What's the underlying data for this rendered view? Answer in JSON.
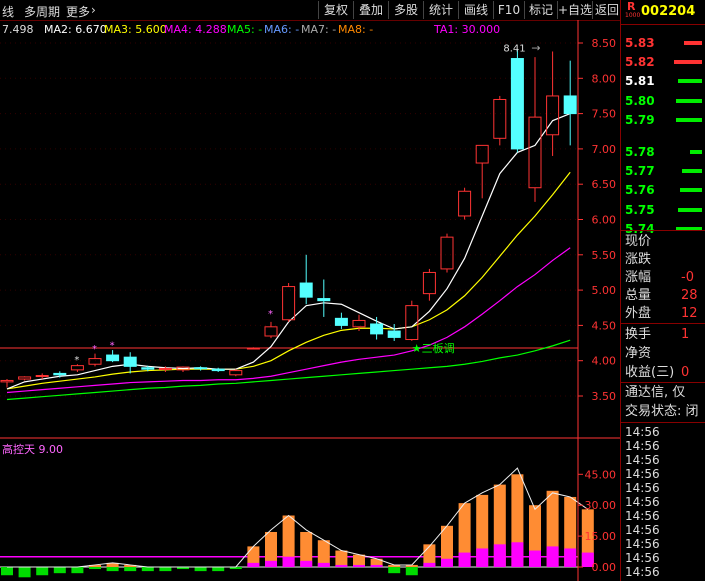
{
  "toolbar": {
    "left_items": [
      "线",
      "多周期",
      "更多"
    ],
    "more_arrow": "›",
    "buttons": [
      "复权",
      "叠加",
      "多股",
      "统计",
      "画线",
      "F10",
      "标记",
      "+自选",
      "返回"
    ]
  },
  "ma_bar": {
    "price": "7.498",
    "ma2": "MA2: 6.670",
    "ma3": "MA3: 5.600",
    "ma4": "MA4: 4.288",
    "ma5": "MA5: -",
    "ma6": "MA6: -",
    "ma7": "MA7: -",
    "ma8": "MA8: -",
    "ta1": "TA1: 30.000"
  },
  "colors": {
    "up": "#ff3333",
    "down": "#54ffff",
    "ma2": "#ffffff",
    "ma3": "#ffff00",
    "ma4": "#ff00ff",
    "ma5": "#00ff00",
    "ta1": "#ff00ff",
    "axis": "#ff3333",
    "green_bar": "#00dd00"
  },
  "main_chart": {
    "y_ticks": [
      "8.50",
      "8.00",
      "7.50",
      "7.00",
      "6.50",
      "6.00",
      "5.50",
      "5.00",
      "4.50",
      "4.00",
      "3.50"
    ],
    "annotation_top": "8.41",
    "annotation_arrow": "→",
    "annotation_signal": "★三板调",
    "stars": [
      "*",
      "*",
      "*",
      "*"
    ],
    "candles": [
      {
        "o": 3.7,
        "h": 3.74,
        "l": 3.62,
        "c": 3.72
      },
      {
        "o": 3.74,
        "h": 3.78,
        "l": 3.72,
        "c": 3.77
      },
      {
        "o": 3.78,
        "h": 3.82,
        "l": 3.74,
        "c": 3.79
      },
      {
        "o": 3.82,
        "h": 3.85,
        "l": 3.76,
        "c": 3.8
      },
      {
        "o": 3.87,
        "h": 3.95,
        "l": 3.84,
        "c": 3.93
      },
      {
        "o": 3.95,
        "h": 4.1,
        "l": 3.92,
        "c": 4.03
      },
      {
        "o": 4.08,
        "h": 4.15,
        "l": 3.98,
        "c": 4.0
      },
      {
        "o": 4.05,
        "h": 4.12,
        "l": 3.82,
        "c": 3.92
      },
      {
        "o": 3.9,
        "h": 3.93,
        "l": 3.85,
        "c": 3.88
      },
      {
        "o": 3.88,
        "h": 3.92,
        "l": 3.84,
        "c": 3.89
      },
      {
        "o": 3.87,
        "h": 3.92,
        "l": 3.84,
        "c": 3.91
      },
      {
        "o": 3.9,
        "h": 3.92,
        "l": 3.86,
        "c": 3.89
      },
      {
        "o": 3.88,
        "h": 3.9,
        "l": 3.84,
        "c": 3.86
      },
      {
        "o": 3.8,
        "h": 3.88,
        "l": 3.78,
        "c": 3.86
      },
      {
        "o": 4.18,
        "h": 4.19,
        "l": 4.17,
        "c": 4.18
      },
      {
        "o": 4.35,
        "h": 4.55,
        "l": 4.32,
        "c": 4.48
      },
      {
        "o": 4.58,
        "h": 5.1,
        "l": 4.55,
        "c": 5.05
      },
      {
        "o": 5.1,
        "h": 5.5,
        "l": 4.8,
        "c": 4.9
      },
      {
        "o": 4.88,
        "h": 5.15,
        "l": 4.62,
        "c": 4.85
      },
      {
        "o": 4.6,
        "h": 4.68,
        "l": 4.45,
        "c": 4.5
      },
      {
        "o": 4.48,
        "h": 4.65,
        "l": 4.42,
        "c": 4.57
      },
      {
        "o": 4.52,
        "h": 4.62,
        "l": 4.3,
        "c": 4.38
      },
      {
        "o": 4.42,
        "h": 4.52,
        "l": 4.28,
        "c": 4.33
      },
      {
        "o": 4.3,
        "h": 4.85,
        "l": 4.28,
        "c": 4.78
      },
      {
        "o": 4.95,
        "h": 5.3,
        "l": 4.85,
        "c": 5.25
      },
      {
        "o": 5.3,
        "h": 5.8,
        "l": 5.25,
        "c": 5.75
      },
      {
        "o": 6.05,
        "h": 6.45,
        "l": 6.0,
        "c": 6.4
      },
      {
        "o": 6.8,
        "h": 7.05,
        "l": 6.3,
        "c": 7.05
      },
      {
        "o": 7.15,
        "h": 7.75,
        "l": 7.05,
        "c": 7.7
      },
      {
        "o": 8.28,
        "h": 8.41,
        "l": 6.95,
        "c": 7.0
      },
      {
        "o": 6.45,
        "h": 8.3,
        "l": 6.25,
        "c": 7.45
      },
      {
        "o": 7.2,
        "h": 8.38,
        "l": 6.9,
        "c": 7.75
      },
      {
        "o": 7.75,
        "h": 8.25,
        "l": 7.05,
        "c": 7.5
      }
    ],
    "ma2": [
      3.6,
      3.7,
      3.74,
      3.78,
      3.8,
      3.86,
      3.92,
      3.95,
      3.92,
      3.9,
      3.89,
      3.9,
      3.88,
      3.88,
      3.98,
      4.2,
      4.55,
      4.78,
      4.82,
      4.8,
      4.68,
      4.56,
      4.45,
      4.48,
      4.7,
      5.02,
      5.45,
      6.05,
      6.65,
      6.95,
      7.05,
      7.4,
      7.5
    ],
    "ma3": [
      3.6,
      3.64,
      3.68,
      3.71,
      3.74,
      3.77,
      3.81,
      3.84,
      3.86,
      3.87,
      3.88,
      3.88,
      3.88,
      3.88,
      3.92,
      4.0,
      4.14,
      4.26,
      4.36,
      4.43,
      4.46,
      4.46,
      4.45,
      4.48,
      4.58,
      4.72,
      4.92,
      5.18,
      5.48,
      5.78,
      6.05,
      6.35,
      6.67
    ],
    "ma4": [
      3.55,
      3.57,
      3.59,
      3.61,
      3.63,
      3.65,
      3.67,
      3.69,
      3.7,
      3.71,
      3.72,
      3.72,
      3.73,
      3.73,
      3.75,
      3.78,
      3.83,
      3.88,
      3.93,
      3.98,
      4.02,
      4.05,
      4.08,
      4.14,
      4.22,
      4.33,
      4.48,
      4.66,
      4.85,
      5.05,
      5.22,
      5.42,
      5.6
    ],
    "ma5": [
      3.45,
      3.47,
      3.49,
      3.51,
      3.53,
      3.55,
      3.57,
      3.59,
      3.61,
      3.62,
      3.64,
      3.65,
      3.67,
      3.68,
      3.7,
      3.72,
      3.74,
      3.76,
      3.78,
      3.8,
      3.82,
      3.84,
      3.86,
      3.88,
      3.9,
      3.92,
      3.95,
      3.99,
      4.04,
      4.08,
      4.14,
      4.21,
      4.29
    ]
  },
  "sub_chart": {
    "title": "高控天 9.00",
    "y_ticks": [
      "45.00",
      "30.00",
      "15.00",
      "0.00"
    ],
    "orange": [
      0,
      0,
      0,
      0,
      0,
      1,
      2,
      1,
      0,
      0,
      0,
      0,
      0,
      0,
      10,
      17,
      25,
      17,
      13,
      8,
      6,
      4,
      1,
      1,
      11,
      20,
      31,
      35,
      40,
      45,
      30,
      37,
      34,
      28
    ],
    "magenta": [
      0,
      0,
      0,
      0,
      0,
      0,
      0,
      0,
      0,
      0,
      0,
      0,
      0,
      0,
      2,
      3,
      5,
      3,
      2,
      1,
      1,
      1,
      0,
      0,
      2,
      4,
      7,
      9,
      11,
      12,
      8,
      10,
      9,
      7
    ],
    "green": [
      -4,
      -5,
      -4,
      -3,
      -3,
      -1,
      -2,
      -2,
      -2,
      -2,
      -1,
      -2,
      -2,
      -1,
      0,
      0,
      0,
      0,
      0,
      0,
      0,
      0,
      -3,
      -4,
      0,
      0,
      0,
      0,
      0,
      0,
      0,
      0,
      0,
      0
    ],
    "line": [
      0,
      0,
      0,
      0,
      0,
      1,
      2,
      1,
      0,
      0,
      0,
      0,
      0,
      0,
      10,
      18,
      25,
      18,
      13,
      8,
      6,
      4,
      1,
      1,
      10,
      20,
      31,
      36,
      40,
      48,
      28,
      36,
      34,
      28
    ],
    "ta1": 5.0
  },
  "right_panel": {
    "logo": "R",
    "logo_sub": "1000",
    "code": "002204",
    "order_book": [
      {
        "price": "5.83",
        "color": "#ff3333",
        "bar": 18
      },
      {
        "price": "5.82",
        "color": "#ff3333",
        "bar": 28
      },
      {
        "price": "5.81",
        "color": "#ffffff",
        "bar": 24
      },
      {
        "price": "5.80",
        "color": "#00ff00",
        "bar": 26
      },
      {
        "price": "5.79",
        "color": "#00ff00",
        "bar": 26
      },
      {
        "price": "5.78",
        "color": "#00ff00",
        "bar": 12
      },
      {
        "price": "5.77",
        "color": "#00ff00",
        "bar": 20
      },
      {
        "price": "5.76",
        "color": "#00ff00",
        "bar": 22
      },
      {
        "price": "5.75",
        "color": "#00ff00",
        "bar": 24
      },
      {
        "price": "5.74",
        "color": "#00ff00",
        "bar": 26
      }
    ],
    "info": [
      {
        "label": "现价",
        "value": ""
      },
      {
        "label": "涨跌",
        "value": ""
      },
      {
        "label": "涨幅",
        "value": "-0"
      },
      {
        "label": "总量",
        "value": "28"
      },
      {
        "label": "外盘",
        "value": "12"
      }
    ],
    "info2": [
      {
        "label": "换手",
        "value": "1"
      },
      {
        "label": "净资",
        "value": ""
      },
      {
        "label": "收益(三)",
        "value": "0"
      }
    ],
    "notice1": "通达信, 仅",
    "notice2": "交易状态: 闭",
    "times": [
      "14:56",
      "14:56",
      "14:56",
      "14:56",
      "14:56",
      "14:56",
      "14:56",
      "14:56",
      "14:56",
      "14:56",
      "14:56"
    ]
  }
}
